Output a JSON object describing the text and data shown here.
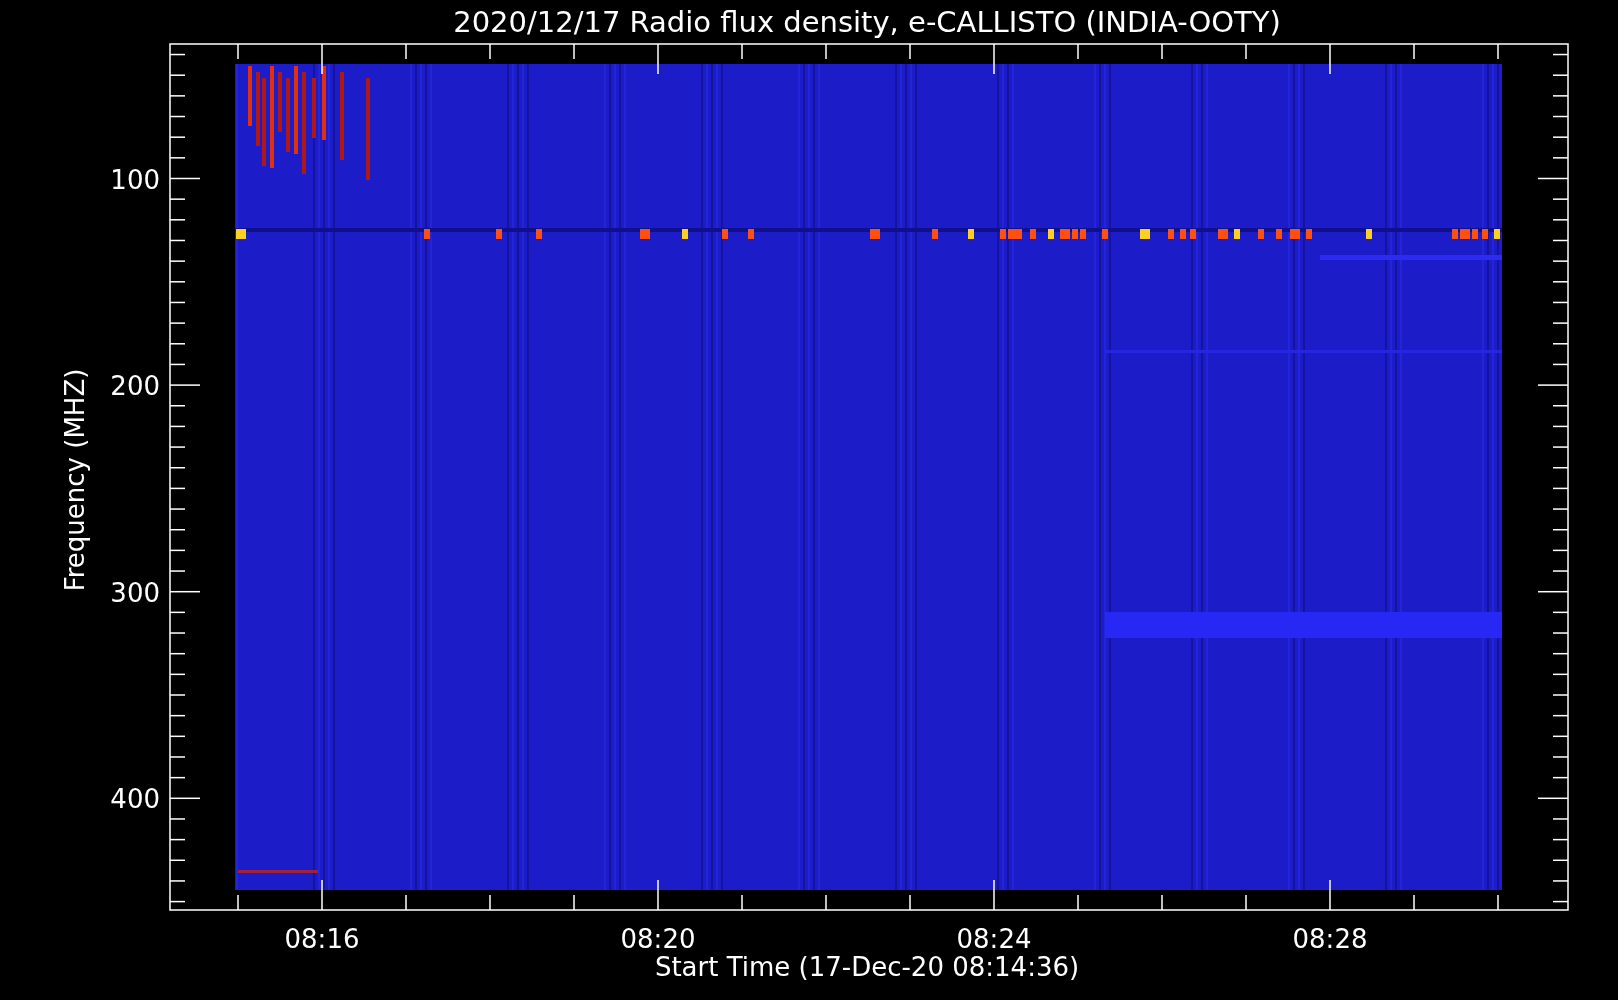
{
  "plot": {
    "title": "2020/12/17  Radio flux density, e-CALLISTO (INDIA-OOTY)",
    "xlabel": "Start Time (17-Dec-20 08:14:36)",
    "ylabel": "Frequency (MHZ)",
    "xtick_labels": [
      "08:16",
      "08:20",
      "08:24",
      "08:28"
    ],
    "ytick_labels": [
      "100",
      "200",
      "300",
      "400"
    ]
  }
}
